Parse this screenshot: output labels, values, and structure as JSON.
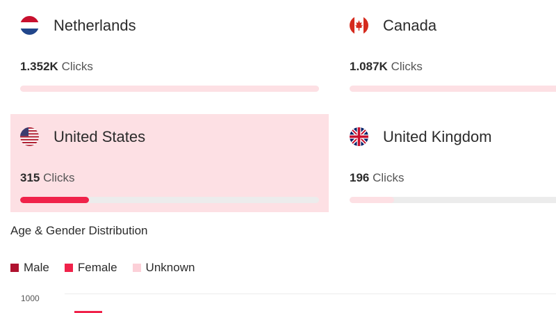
{
  "countries": [
    {
      "name": "Netherlands",
      "clicks_value": "1.352K",
      "clicks_label": "Clicks",
      "fill": 1.0,
      "fill_color": "#fde0e4",
      "flag": "netherlands-flag"
    },
    {
      "name": "Canada",
      "clicks_value": "1.087K",
      "clicks_label": "Clicks",
      "fill": 1.0,
      "fill_color": "#fde0e4",
      "flag": "canada-flag"
    },
    {
      "name": "United States",
      "clicks_value": "315",
      "clicks_label": "Clicks",
      "fill": 0.23,
      "fill_color": "#f0224a",
      "flag": "usa-flag"
    },
    {
      "name": "United Kingdom",
      "clicks_value": "196",
      "clicks_label": "Clicks",
      "fill": 0.2,
      "fill_color": "#fde0e4",
      "flag": "uk-flag"
    }
  ],
  "age_gender": {
    "title": "Age & Gender Distribution",
    "legend": [
      {
        "label": "Male",
        "color": "#b0122f"
      },
      {
        "label": "Female",
        "color": "#f0224a"
      },
      {
        "label": "Unknown",
        "color": "#fcd0d8"
      }
    ],
    "y_tick": "1000"
  },
  "colors": {
    "highlight_bg": "#fde0e4",
    "accent": "#f0224a",
    "track": "#ececec"
  }
}
